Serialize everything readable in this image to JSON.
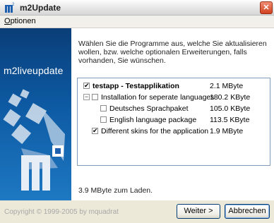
{
  "window": {
    "title": "m2Update",
    "close_glyph": "✕"
  },
  "menu": {
    "options_first": "O",
    "options_rest": "ptionen"
  },
  "banner": {
    "title": "m2liveupdate"
  },
  "content": {
    "instructions": "Wählen Sie die Programme aus, welche Sie aktualisieren wollen, bzw. welche optionalen Erweiterungen, falls vorhanden, Sie wünschen.",
    "tree": [
      {
        "label": "testapp - Testapplikation",
        "size": "2.1 MByte",
        "checked": true,
        "bold": true
      },
      {
        "label": "Installation for seperate languages",
        "size": "180.2 KByte",
        "checked": false,
        "expander": "−"
      },
      {
        "label": "Deutsches Sprachpaket",
        "size": "105.0 KByte",
        "checked": false
      },
      {
        "label": "English language package",
        "size": "113.5 KByte",
        "checked": false
      },
      {
        "label": "Different skins for the application",
        "size": "1.9 MByte",
        "checked": true
      }
    ],
    "status": "3.9 MByte zum Laden."
  },
  "footer": {
    "copyright": "Copyright © 1999-2005 by mquadrat",
    "next_button": "Weiter >",
    "cancel_button": "Abbrechen"
  }
}
